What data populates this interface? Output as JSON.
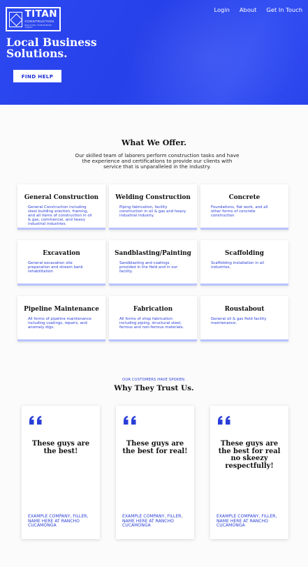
{
  "header": {
    "logo": {
      "main": "TITAN",
      "sub": "CONSTRUCTION",
      "tagline": "BUILDING TOMORROW TODAY"
    },
    "nav": [
      {
        "label": "Login"
      },
      {
        "label": "About"
      },
      {
        "label": "Get In Touch"
      }
    ]
  },
  "hero": {
    "title": "Local Business Solutions.",
    "cta": "FIND HELP"
  },
  "offer": {
    "title": "What We Offer.",
    "description": "Our skilled team of laborers perform construction tasks and have the experience and certifications to provide our clients with service that is unparalleled in the industry.",
    "services": [
      {
        "title": "General Construction",
        "text": "General Construction including steel building erection, framing, and all items of construction in oil & gas, commercial, and heavy industrial industries."
      },
      {
        "title": "Welding Construction",
        "text": "Piping fabrication, facility construction in oil & gas and heavy industrial industry."
      },
      {
        "title": "Concrete",
        "text": "Foundations, flat work, and all other forms of concrete construction"
      },
      {
        "title": "Excavation",
        "text": "General excavation site preparation and stream bank rehabilitation"
      },
      {
        "title": "Sandblasting/Painting",
        "text": "Sandblasting and coatings provided in the field and in our facility."
      },
      {
        "title": "Scaffolding",
        "text": "Scaffolding installation in all industries."
      },
      {
        "title": "Pipeline Maintenance",
        "text": "All forms of pipeline maintenance including coatings, repairs, and anomaly digs."
      },
      {
        "title": "Fabrication",
        "text": "All forms of shop fabrication including piping, structural steel, ferrous and non-ferrous materials."
      },
      {
        "title": "Roustabout",
        "text": "General oil & gas field facility maintenance."
      }
    ]
  },
  "testimonials": {
    "eyebrow": "OUR CUSTOMERS HAVE SPOKEN.",
    "title": "Why They Trust Us.",
    "quote_icon": "quote-icon",
    "accent": "#2a3fd8",
    "items": [
      {
        "quote": "These guys are the best!",
        "author": "EXAMPLE COMPANY, FILLER, NAME HERE AT RANCHO CUCAMONGA"
      },
      {
        "quote": "These guys are the best for real!",
        "author": "EXAMPLE COMPANY, FILLER, NAME HERE AT RANCHO CUCAMONGA"
      },
      {
        "quote": "These guys are the best for real no skeezy respectfully!",
        "author": "EXAMPLE COMPANY, FILLER, NAME HERE AT RANCHO CUCAMONGA"
      }
    ]
  }
}
